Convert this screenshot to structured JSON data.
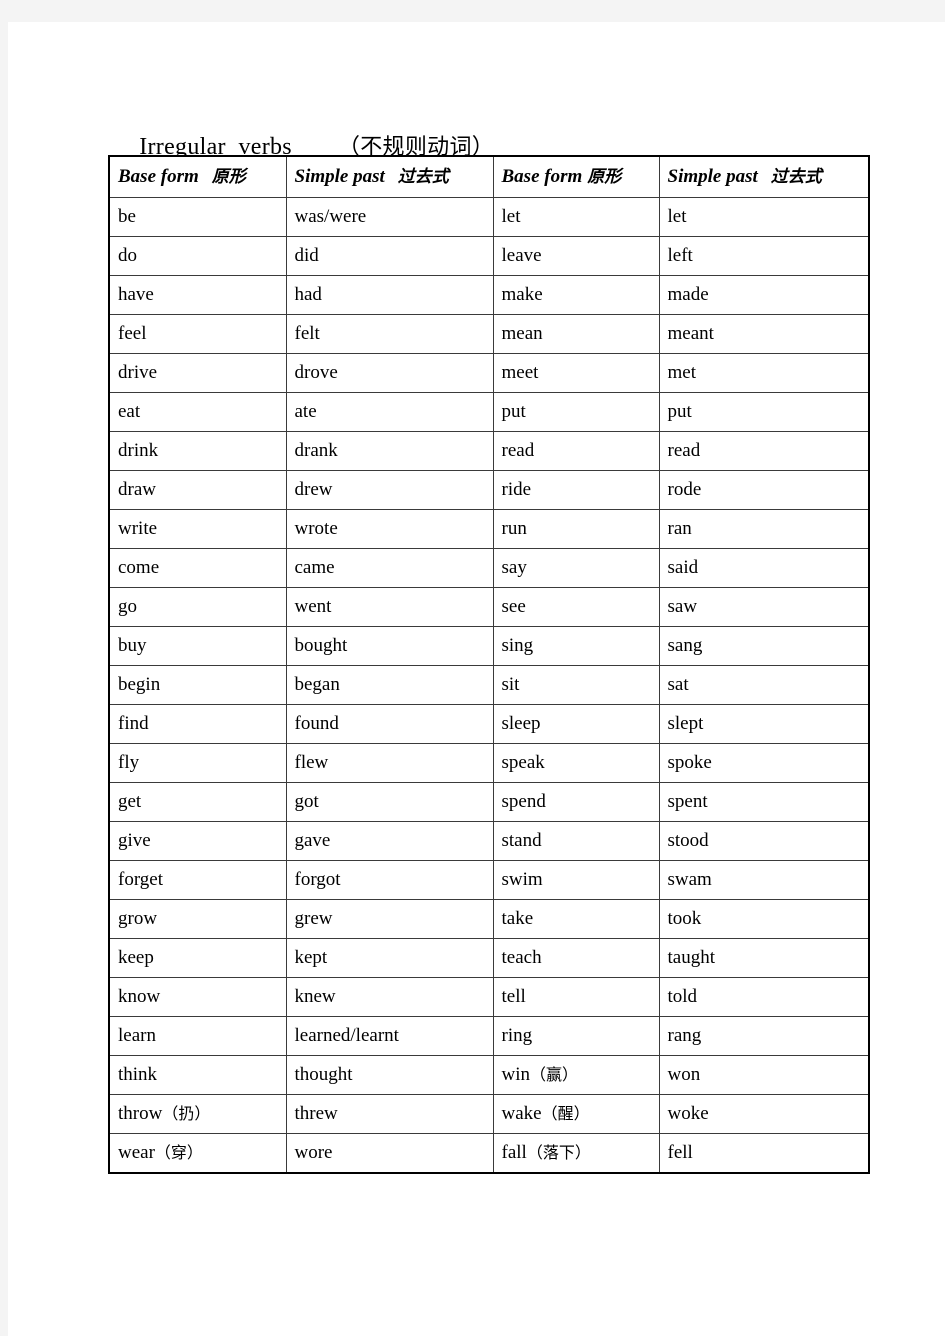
{
  "document": {
    "title_en": "Irregular  verbs",
    "title_cn": "（不规则动词）"
  },
  "table": {
    "headers": [
      {
        "en": "Base form",
        "cn": "原形",
        "gap": "wide"
      },
      {
        "en": "Simple past",
        "cn": "过去式",
        "gap": "wide"
      },
      {
        "en": "Base form",
        "cn": "原形",
        "gap": "narrow"
      },
      {
        "en": "Simple past",
        "cn": "过去式",
        "gap": "wide"
      }
    ],
    "rows": [
      {
        "left_base": "be",
        "left_past": "was/were",
        "right_base": "let",
        "right_base_cn": "",
        "right_past": "let"
      },
      {
        "left_base": "do",
        "left_past": "did",
        "right_base": "leave",
        "right_base_cn": "",
        "right_past": "left"
      },
      {
        "left_base": "have",
        "left_past": "had",
        "right_base": "make",
        "right_base_cn": "",
        "right_past": "made"
      },
      {
        "left_base": "feel",
        "left_past": "felt",
        "right_base": "mean",
        "right_base_cn": "",
        "right_past": "meant"
      },
      {
        "left_base": "drive",
        "left_past": "drove",
        "right_base": "meet",
        "right_base_cn": "",
        "right_past": "met"
      },
      {
        "left_base": "eat",
        "left_past": "ate",
        "right_base": "put",
        "right_base_cn": "",
        "right_past": "put"
      },
      {
        "left_base": "drink",
        "left_past": "drank",
        "right_base": "read",
        "right_base_cn": "",
        "right_past": "read"
      },
      {
        "left_base": "draw",
        "left_past": "drew",
        "right_base": "ride",
        "right_base_cn": "",
        "right_past": "rode"
      },
      {
        "left_base": "write",
        "left_past": "wrote",
        "right_base": "run",
        "right_base_cn": "",
        "right_past": "ran"
      },
      {
        "left_base": "come",
        "left_past": "came",
        "right_base": "say",
        "right_base_cn": "",
        "right_past": "said"
      },
      {
        "left_base": "go",
        "left_past": "went",
        "right_base": "see",
        "right_base_cn": "",
        "right_past": "saw"
      },
      {
        "left_base": "buy",
        "left_past": "bought",
        "right_base": "sing",
        "right_base_cn": "",
        "right_past": "sang"
      },
      {
        "left_base": "begin",
        "left_past": "began",
        "right_base": "sit",
        "right_base_cn": "",
        "right_past": "sat"
      },
      {
        "left_base": "find",
        "left_past": "found",
        "right_base": "sleep",
        "right_base_cn": "",
        "right_past": "slept"
      },
      {
        "left_base": "fly",
        "left_past": "flew",
        "right_base": "speak",
        "right_base_cn": "",
        "right_past": "spoke"
      },
      {
        "left_base": "get",
        "left_past": "got",
        "right_base": "spend",
        "right_base_cn": "",
        "right_past": "spent"
      },
      {
        "left_base": "give",
        "left_past": "gave",
        "right_base": "stand",
        "right_base_cn": "",
        "right_past": "stood"
      },
      {
        "left_base": "forget",
        "left_past": "forgot",
        "right_base": "swim",
        "right_base_cn": "",
        "right_past": "swam"
      },
      {
        "left_base": "grow",
        "left_past": "grew",
        "right_base": "take",
        "right_base_cn": "",
        "right_past": "took"
      },
      {
        "left_base": "keep",
        "left_past": "kept",
        "right_base": "teach",
        "right_base_cn": "",
        "right_past": "taught"
      },
      {
        "left_base": "know",
        "left_past": "knew",
        "right_base": "tell",
        "right_base_cn": "",
        "right_past": "told"
      },
      {
        "left_base": "learn",
        "left_past": "learned/learnt",
        "right_base": "ring",
        "right_base_cn": "",
        "right_past": "rang"
      },
      {
        "left_base": "think",
        "left_past": "thought",
        "right_base": "win",
        "right_base_cn": "（赢）",
        "right_past": "won"
      },
      {
        "left_base": "throw",
        "left_base_cn": "（扔）",
        "left_past": "threw",
        "right_base": "wake",
        "right_base_cn": "（醒）",
        "right_past": "woke"
      },
      {
        "left_base": "wear",
        "left_base_cn": "（穿）",
        "left_past": "wore",
        "right_base": "fall",
        "right_base_cn": "（落下）",
        "right_past": "fell"
      }
    ]
  }
}
